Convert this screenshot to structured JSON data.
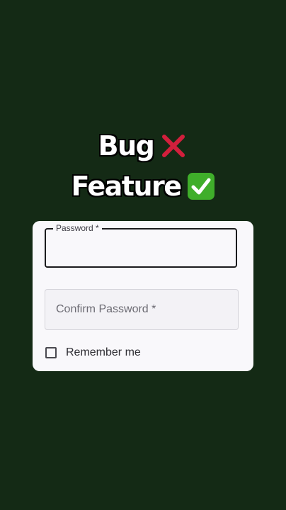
{
  "overlay": {
    "line1_text": "Bug",
    "line1_icon": "cross-mark-icon",
    "line2_text": "Feature",
    "line2_icon": "check-mark-icon",
    "cross_color": "#d21f3c",
    "check_color": "#3fae2a"
  },
  "form": {
    "password": {
      "label": "Password *",
      "value": ""
    },
    "confirm_password": {
      "placeholder": "Confirm Password *",
      "value": ""
    },
    "remember_me": {
      "label": "Remember me",
      "checked": false
    }
  },
  "colors": {
    "background": "#142a15",
    "card": "#f9f8fb",
    "focused_border": "#1b1b1d",
    "idle_border": "#d5d4da"
  }
}
